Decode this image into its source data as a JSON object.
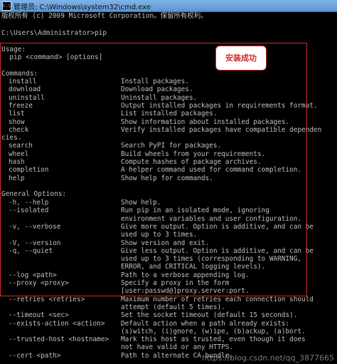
{
  "window": {
    "title": "管理员: C:\\Windows\\system32\\cmd.exe",
    "icon": "console-icon"
  },
  "console": {
    "header": "版权所有 (c) 2009 Microsoft Corporation。保留所有权利。",
    "prompt": "C:\\Users\\Administrator>pip",
    "usage_label": "Usage:",
    "usage_line": "  pip <command> [options]",
    "commands_label": "Commands:",
    "commands": [
      {
        "name": "install",
        "desc": "Install packages."
      },
      {
        "name": "download",
        "desc": "Download packages."
      },
      {
        "name": "uninstall",
        "desc": "Uninstall packages."
      },
      {
        "name": "freeze",
        "desc": "Output installed packages in requirements format."
      },
      {
        "name": "list",
        "desc": "List installed packages."
      },
      {
        "name": "show",
        "desc": "Show information about installed packages."
      },
      {
        "name": "check",
        "desc": "Verify installed packages have compatible dependen"
      },
      {
        "name": "",
        "desc": ""
      },
      {
        "name": "search",
        "desc": "Search PyPI for packages."
      },
      {
        "name": "wheel",
        "desc": "Build wheels from your requirements."
      },
      {
        "name": "hash",
        "desc": "Compute hashes of package archives."
      },
      {
        "name": "completion",
        "desc": "A helper command used for command completion."
      },
      {
        "name": "help",
        "desc": "Show help for commands."
      }
    ],
    "wrap_text": "cies.",
    "options_label": "General Options:",
    "options": [
      {
        "name": "-h, --help",
        "desc": "Show help."
      },
      {
        "name": "--isolated",
        "desc": "Run pip in an isolated mode, ignoring"
      },
      {
        "name": "",
        "desc": "environment variables and user configuration."
      },
      {
        "name": "-v, --verbose",
        "desc": "Give more output. Option is additive, and can be"
      },
      {
        "name": "",
        "desc": "used up to 3 times."
      },
      {
        "name": "-V, --version",
        "desc": "Show version and exit."
      },
      {
        "name": "-q, --quiet",
        "desc": "Give less output. Option is additive, and can be"
      },
      {
        "name": "",
        "desc": "used up to 3 times (corresponding to WARNING,"
      },
      {
        "name": "",
        "desc": "ERROR, and CRITICAL logging levels)."
      },
      {
        "name": "--log <path>",
        "desc": "Path to a verbose appending log."
      },
      {
        "name": "--proxy <proxy>",
        "desc": "Specify a proxy in the form"
      },
      {
        "name": "",
        "desc": "[user:passwd@]proxy.server:port."
      },
      {
        "name": "--retries <retries>",
        "desc": "Maximum number of retries each connection should"
      },
      {
        "name": "",
        "desc": "attempt (default 5 times)."
      },
      {
        "name": "--timeout <sec>",
        "desc": "Set the socket timeout (default 15 seconds)."
      },
      {
        "name": "--exists-action <action>",
        "desc": "Default action when a path already exists:"
      },
      {
        "name": "",
        "desc": "(s)witch, (i)gnore, (w)ipe, (b)ackup, (a)bort."
      },
      {
        "name": "--trusted-host <hostname>",
        "desc": "Mark this host as trusted, even though it does"
      },
      {
        "name": "",
        "desc": "not have valid or any HTTPS."
      },
      {
        "name": "--cert <path>",
        "desc": "Path to alternate CA bundle."
      }
    ]
  },
  "annotation": {
    "callout_text": "安装成功",
    "color": "#d32a2a"
  },
  "watermark": "https://blog.csdn.net/qq_3877665"
}
